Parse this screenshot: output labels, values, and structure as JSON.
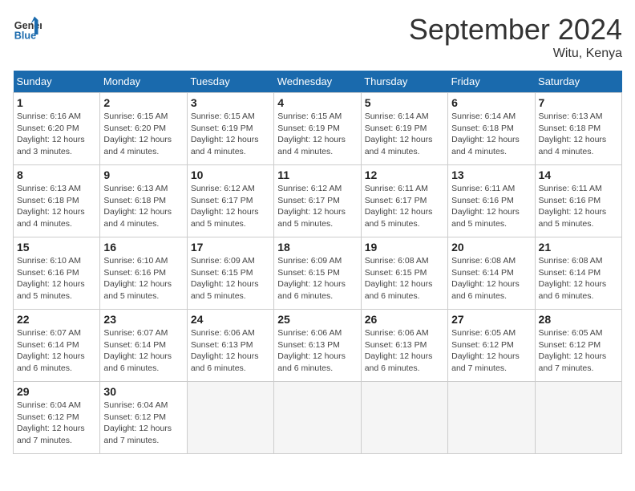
{
  "header": {
    "logo_line1": "General",
    "logo_line2": "Blue",
    "month": "September 2024",
    "location": "Witu, Kenya"
  },
  "days_of_week": [
    "Sunday",
    "Monday",
    "Tuesday",
    "Wednesday",
    "Thursday",
    "Friday",
    "Saturday"
  ],
  "weeks": [
    [
      {
        "day": 1,
        "sunrise": "6:16 AM",
        "sunset": "6:20 PM",
        "daylight": "12 hours and 3 minutes."
      },
      {
        "day": 2,
        "sunrise": "6:15 AM",
        "sunset": "6:20 PM",
        "daylight": "12 hours and 4 minutes."
      },
      {
        "day": 3,
        "sunrise": "6:15 AM",
        "sunset": "6:19 PM",
        "daylight": "12 hours and 4 minutes."
      },
      {
        "day": 4,
        "sunrise": "6:15 AM",
        "sunset": "6:19 PM",
        "daylight": "12 hours and 4 minutes."
      },
      {
        "day": 5,
        "sunrise": "6:14 AM",
        "sunset": "6:19 PM",
        "daylight": "12 hours and 4 minutes."
      },
      {
        "day": 6,
        "sunrise": "6:14 AM",
        "sunset": "6:18 PM",
        "daylight": "12 hours and 4 minutes."
      },
      {
        "day": 7,
        "sunrise": "6:13 AM",
        "sunset": "6:18 PM",
        "daylight": "12 hours and 4 minutes."
      }
    ],
    [
      {
        "day": 8,
        "sunrise": "6:13 AM",
        "sunset": "6:18 PM",
        "daylight": "12 hours and 4 minutes."
      },
      {
        "day": 9,
        "sunrise": "6:13 AM",
        "sunset": "6:18 PM",
        "daylight": "12 hours and 4 minutes."
      },
      {
        "day": 10,
        "sunrise": "6:12 AM",
        "sunset": "6:17 PM",
        "daylight": "12 hours and 5 minutes."
      },
      {
        "day": 11,
        "sunrise": "6:12 AM",
        "sunset": "6:17 PM",
        "daylight": "12 hours and 5 minutes."
      },
      {
        "day": 12,
        "sunrise": "6:11 AM",
        "sunset": "6:17 PM",
        "daylight": "12 hours and 5 minutes."
      },
      {
        "day": 13,
        "sunrise": "6:11 AM",
        "sunset": "6:16 PM",
        "daylight": "12 hours and 5 minutes."
      },
      {
        "day": 14,
        "sunrise": "6:11 AM",
        "sunset": "6:16 PM",
        "daylight": "12 hours and 5 minutes."
      }
    ],
    [
      {
        "day": 15,
        "sunrise": "6:10 AM",
        "sunset": "6:16 PM",
        "daylight": "12 hours and 5 minutes."
      },
      {
        "day": 16,
        "sunrise": "6:10 AM",
        "sunset": "6:16 PM",
        "daylight": "12 hours and 5 minutes."
      },
      {
        "day": 17,
        "sunrise": "6:09 AM",
        "sunset": "6:15 PM",
        "daylight": "12 hours and 5 minutes."
      },
      {
        "day": 18,
        "sunrise": "6:09 AM",
        "sunset": "6:15 PM",
        "daylight": "12 hours and 6 minutes."
      },
      {
        "day": 19,
        "sunrise": "6:08 AM",
        "sunset": "6:15 PM",
        "daylight": "12 hours and 6 minutes."
      },
      {
        "day": 20,
        "sunrise": "6:08 AM",
        "sunset": "6:14 PM",
        "daylight": "12 hours and 6 minutes."
      },
      {
        "day": 21,
        "sunrise": "6:08 AM",
        "sunset": "6:14 PM",
        "daylight": "12 hours and 6 minutes."
      }
    ],
    [
      {
        "day": 22,
        "sunrise": "6:07 AM",
        "sunset": "6:14 PM",
        "daylight": "12 hours and 6 minutes."
      },
      {
        "day": 23,
        "sunrise": "6:07 AM",
        "sunset": "6:14 PM",
        "daylight": "12 hours and 6 minutes."
      },
      {
        "day": 24,
        "sunrise": "6:06 AM",
        "sunset": "6:13 PM",
        "daylight": "12 hours and 6 minutes."
      },
      {
        "day": 25,
        "sunrise": "6:06 AM",
        "sunset": "6:13 PM",
        "daylight": "12 hours and 6 minutes."
      },
      {
        "day": 26,
        "sunrise": "6:06 AM",
        "sunset": "6:13 PM",
        "daylight": "12 hours and 6 minutes."
      },
      {
        "day": 27,
        "sunrise": "6:05 AM",
        "sunset": "6:12 PM",
        "daylight": "12 hours and 7 minutes."
      },
      {
        "day": 28,
        "sunrise": "6:05 AM",
        "sunset": "6:12 PM",
        "daylight": "12 hours and 7 minutes."
      }
    ],
    [
      {
        "day": 29,
        "sunrise": "6:04 AM",
        "sunset": "6:12 PM",
        "daylight": "12 hours and 7 minutes."
      },
      {
        "day": 30,
        "sunrise": "6:04 AM",
        "sunset": "6:12 PM",
        "daylight": "12 hours and 7 minutes."
      },
      null,
      null,
      null,
      null,
      null
    ]
  ]
}
